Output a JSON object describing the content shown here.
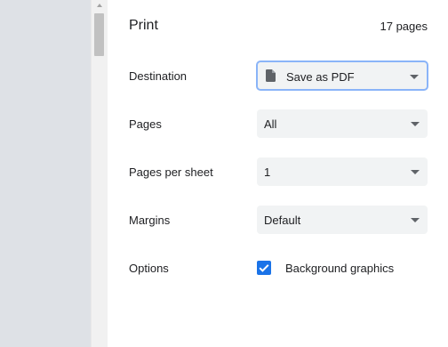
{
  "header": {
    "title": "Print",
    "page_count": "17 pages"
  },
  "settings": {
    "destination": {
      "label": "Destination",
      "value": "Save as PDF",
      "icon": "document-icon"
    },
    "pages": {
      "label": "Pages",
      "value": "All"
    },
    "pages_per_sheet": {
      "label": "Pages per sheet",
      "value": "1"
    },
    "margins": {
      "label": "Margins",
      "value": "Default"
    },
    "options": {
      "label": "Options",
      "background_graphics_label": "Background graphics",
      "background_graphics_checked": true
    }
  },
  "colors": {
    "accent": "#1a73e8",
    "preview_bg": "#dee1e6",
    "select_bg": "#f1f3f4"
  }
}
